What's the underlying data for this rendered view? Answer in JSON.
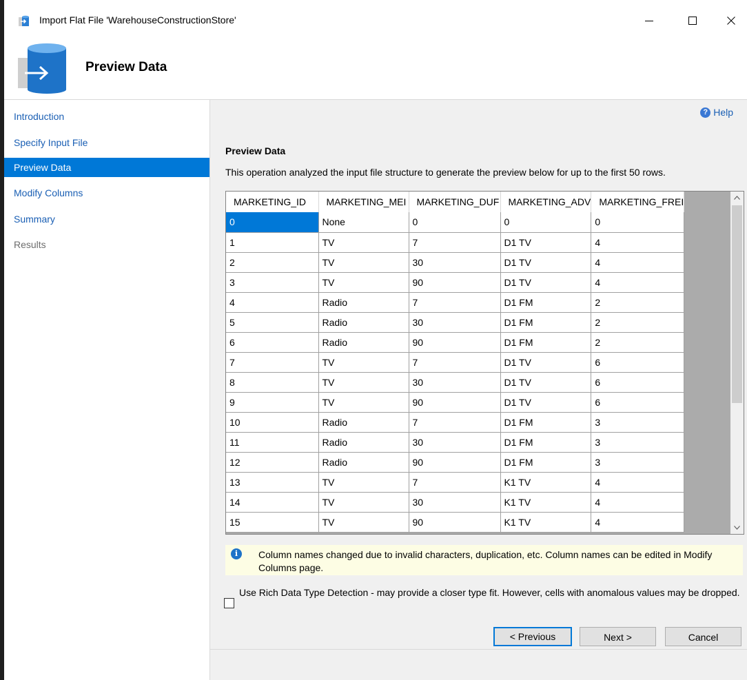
{
  "window": {
    "title": "Import Flat File 'WarehouseConstructionStore'",
    "controls": {
      "minimize": "minimize-icon",
      "maximize": "maximize-icon",
      "close": "close-icon"
    }
  },
  "header": {
    "title": "Preview Data"
  },
  "sidebar": {
    "items": [
      {
        "label": "Introduction",
        "state": "link"
      },
      {
        "label": "Specify Input File",
        "state": "link"
      },
      {
        "label": "Preview Data",
        "state": "selected"
      },
      {
        "label": "Modify Columns",
        "state": "link"
      },
      {
        "label": "Summary",
        "state": "link"
      },
      {
        "label": "Results",
        "state": "disabled"
      }
    ]
  },
  "main": {
    "help_label": "Help",
    "section_title": "Preview Data",
    "description": "This operation analyzed the input file structure to generate the preview below for up to the first 50 rows.",
    "grid": {
      "columns": [
        "MARKETING_ID",
        "MARKETING_MEI",
        "MARKETING_DUF",
        "MARKETING_ADV",
        "MARKETING_FREI"
      ],
      "rows": [
        [
          "0",
          "None",
          "0",
          "0",
          "0"
        ],
        [
          "1",
          "TV",
          "7",
          "D1 TV",
          "4"
        ],
        [
          "2",
          "TV",
          "30",
          "D1 TV",
          "4"
        ],
        [
          "3",
          "TV",
          "90",
          "D1 TV",
          "4"
        ],
        [
          "4",
          "Radio",
          "7",
          "D1 FM",
          "2"
        ],
        [
          "5",
          "Radio",
          "30",
          "D1 FM",
          "2"
        ],
        [
          "6",
          "Radio",
          "90",
          "D1 FM",
          "2"
        ],
        [
          "7",
          "TV",
          "7",
          "D1 TV",
          "6"
        ],
        [
          "8",
          "TV",
          "30",
          "D1 TV",
          "6"
        ],
        [
          "9",
          "TV",
          "90",
          "D1 TV",
          "6"
        ],
        [
          "10",
          "Radio",
          "7",
          "D1 FM",
          "3"
        ],
        [
          "11",
          "Radio",
          "30",
          "D1 FM",
          "3"
        ],
        [
          "12",
          "Radio",
          "90",
          "D1 FM",
          "3"
        ],
        [
          "13",
          "TV",
          "7",
          "K1 TV",
          "4"
        ],
        [
          "14",
          "TV",
          "30",
          "K1 TV",
          "4"
        ],
        [
          "15",
          "TV",
          "90",
          "K1 TV",
          "4"
        ]
      ]
    },
    "info_message": "Column names changed due to invalid characters, duplication, etc. Column names can be edited in Modify Columns page.",
    "rich_detection": {
      "label": "Use Rich Data Type Detection - may provide a closer type fit. However, cells with anomalous values may be dropped.",
      "checked": false
    }
  },
  "footer": {
    "previous_label": "< Previous",
    "next_label": "Next >",
    "cancel_label": "Cancel"
  },
  "colors": {
    "accent": "#0078d7",
    "link": "#1a5fb4",
    "info_bg": "#fdfde4",
    "panel_bg": "#f0f0f0"
  }
}
